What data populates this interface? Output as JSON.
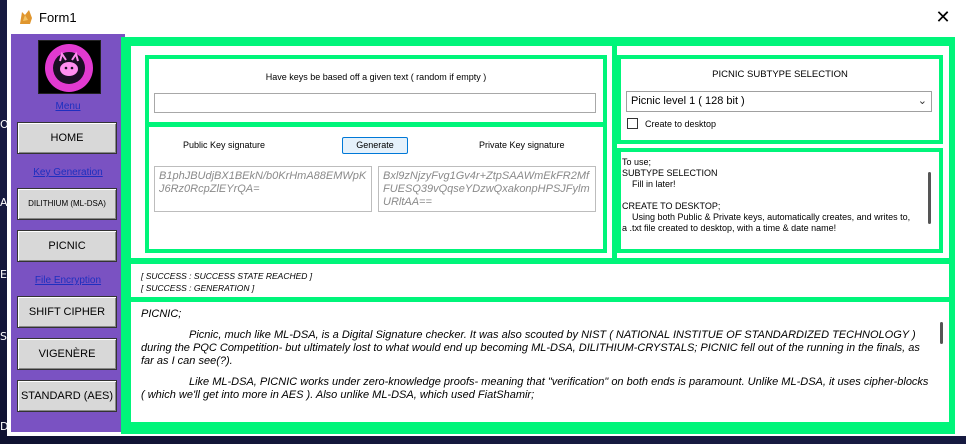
{
  "window": {
    "title": "Form1",
    "close_glyph": "✕"
  },
  "desktop_letters": [
    "O",
    "As",
    "En",
    "SS",
    "De"
  ],
  "sidebar": {
    "links": {
      "menu": "Menu",
      "key_generation": "Key Generation",
      "file_encryption": "File Encryption"
    },
    "buttons": {
      "home": "HOME",
      "dilithium": "DILITHIUM (ML-DSA)",
      "picnic": "PICNIC",
      "shift": "SHIFT CIPHER",
      "vigenere": "VIGENÈRE",
      "standard": "STANDARD (AES)"
    }
  },
  "keys": {
    "seed_label": "Have keys be based off a given text ( random if empty )",
    "seed_value": "",
    "public_label": "Public Key signature",
    "private_label": "Private Key signature",
    "generate_label": "Generate",
    "public_key": "B1phJBUdjBX1BEkN/b0KrHmA88EMWpKJ6Rz0RcpZlEYrQA=",
    "private_key": "Bxl9zNjzyFvg1Gv4r+ZtpSAAWmEkFR2MfFUESQ39vQqseYDzwQxakonpHPSJFylmURltAA=="
  },
  "subtype": {
    "heading": "PICNIC SUBTYPE SELECTION",
    "selected": "Picnic level 1 ( 128 bit )",
    "checkbox_label": "Create to desktop",
    "checked": false
  },
  "instructions": {
    "text": "To use;\nSUBTYPE SELECTION\n    Fill in later!\n\nCREATE TO DESKTOP;\n    Using both Public & Private keys, automatically creates, and writes to,\na .txt file created to desktop, with a time & date name!"
  },
  "status": {
    "line1": "[ SUCCESS : SUCCESS STATE REACHED ]",
    "line2": "[ SUCCESS : GENERATION ]"
  },
  "description": {
    "p1": "PICNIC;",
    "p2": "Picnic, much like ML-DSA, is a Digital Signature checker. It was also scouted by NIST ( NATIONAL INSTITUE OF STANDARDIZED TECHNOLOGY ) during the PQC Competition- but ultimately lost to what would end up becoming ML-DSA, DILITHIUM-CRYSTALS; PICNIC fell out of the running in the finals, as far as I can see(?).",
    "p3": "Like ML-DSA, PICNIC works under zero-knowledge proofs- meaning that \"verification\" on both ends is paramount. Unlike ML-DSA, it uses cipher-blocks ( which we'll get into more in AES ). Also unlike ML-DSA, which used FiatShamir;"
  }
}
